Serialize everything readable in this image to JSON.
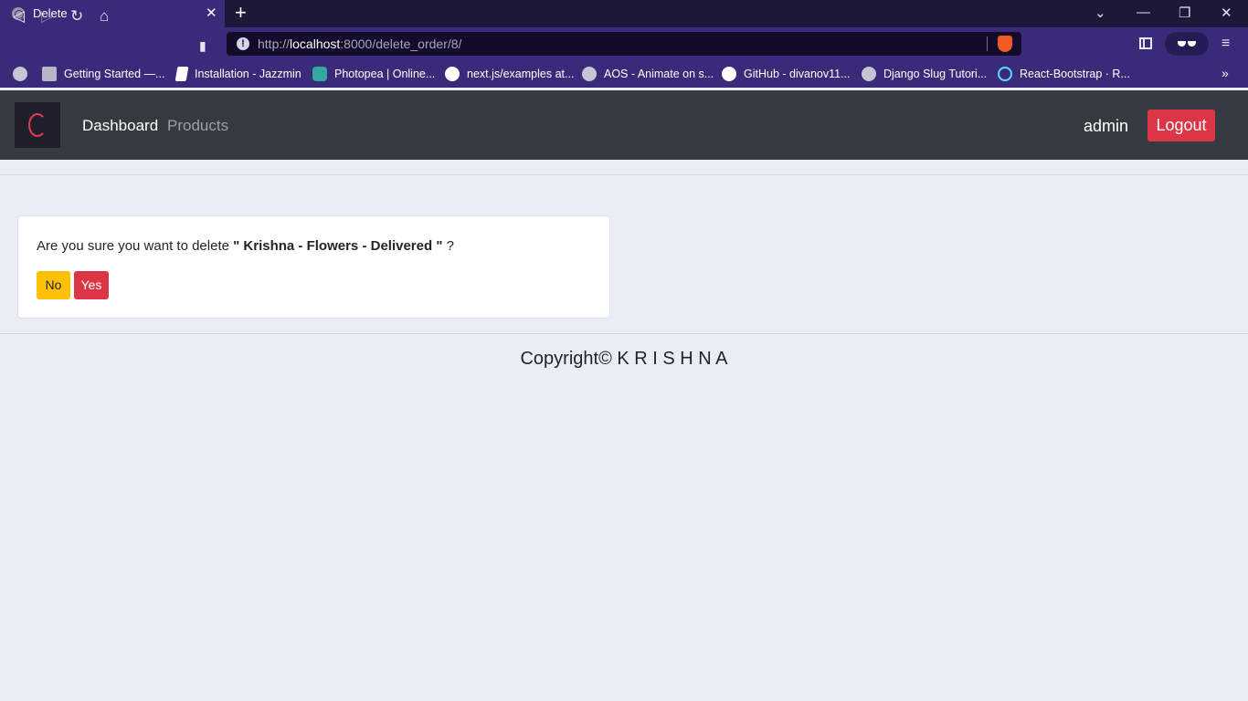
{
  "browser": {
    "tab": {
      "title": "Delete",
      "close": "✕"
    },
    "new_tab": "+",
    "window_controls": {
      "tabs_menu": "⌄",
      "minimize": "—",
      "restore": "❐",
      "close": "✕"
    },
    "nav": {
      "back": "◁",
      "forward": "▷",
      "reload": "↻",
      "home": "⌂",
      "bookmark": "🔖"
    },
    "url": {
      "scheme": "http://",
      "host": "localhost",
      "rest": ":8000/delete_order/8/"
    },
    "menu": "≡",
    "bookmarks": [
      {
        "label": "Getting Started —...",
        "icon": "grid-icon"
      },
      {
        "label": "Installation - Jazzmin",
        "icon": "book-icon"
      },
      {
        "label": "Photopea | Online...",
        "icon": "photopea-icon"
      },
      {
        "label": "next.js/examples at...",
        "icon": "github-icon"
      },
      {
        "label": "AOS - Animate on s...",
        "icon": "globe-icon"
      },
      {
        "label": "GitHub - divanov11...",
        "icon": "github-icon"
      },
      {
        "label": "Django Slug Tutori...",
        "icon": "globe-icon"
      },
      {
        "label": "React-Bootstrap · R...",
        "icon": "react-icon"
      }
    ],
    "bookmarks_more": "»"
  },
  "navbar": {
    "links": [
      "Dashboard",
      "Products"
    ],
    "user": "admin",
    "logout_label": "Logout"
  },
  "confirm": {
    "prefix": "Are you sure you want to delete ",
    "item": "\" Krishna - Flowers - Delivered \"",
    "suffix": " ?",
    "no_label": "No",
    "yes_label": "Yes"
  },
  "footer": {
    "text": "Copyright© K R I S H N A"
  },
  "colors": {
    "chrome": "#3a2a7a",
    "navbar": "#343a40",
    "danger": "#dc3545",
    "warning": "#ffc107",
    "page_bg": "#e9edf5"
  }
}
